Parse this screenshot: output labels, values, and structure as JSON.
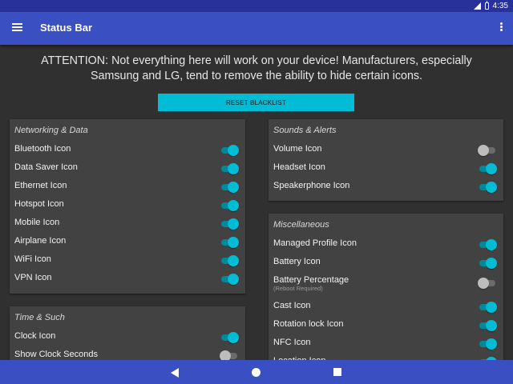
{
  "status_bar": {
    "time": "4:35"
  },
  "app_bar": {
    "title": "Status Bar"
  },
  "attention": "ATTENTION: Not everything here will work on your device! Manufacturers, especially Samsung and LG, tend to remove the ability to hide certain icons.",
  "reset_button": "RESET BLACKLIST",
  "networking": {
    "title": "Networking & Data",
    "items": [
      {
        "label": "Bluetooth Icon",
        "on": true
      },
      {
        "label": "Data Saver Icon",
        "on": true
      },
      {
        "label": "Ethernet Icon",
        "on": true
      },
      {
        "label": "Hotspot Icon",
        "on": true
      },
      {
        "label": "Mobile Icon",
        "on": true
      },
      {
        "label": "Airplane Icon",
        "on": true
      },
      {
        "label": "WiFi Icon",
        "on": true
      },
      {
        "label": "VPN Icon",
        "on": true
      }
    ]
  },
  "time_such": {
    "title": "Time & Such",
    "items": [
      {
        "label": "Clock Icon",
        "on": true
      },
      {
        "label": "Show Clock Seconds",
        "on": false
      }
    ]
  },
  "sounds": {
    "title": "Sounds & Alerts",
    "items": [
      {
        "label": "Volume Icon",
        "on": false
      },
      {
        "label": "Headset Icon",
        "on": true
      },
      {
        "label": "Speakerphone Icon",
        "on": true
      }
    ]
  },
  "misc": {
    "title": "Miscellaneous",
    "items": [
      {
        "label": "Managed Profile Icon",
        "on": true
      },
      {
        "label": "Battery Icon",
        "on": true
      },
      {
        "label": "Battery Percentage",
        "sub": "(Reboot Required)",
        "on": false
      },
      {
        "label": "Cast Icon",
        "on": true
      },
      {
        "label": "Rotation lock Icon",
        "on": true
      },
      {
        "label": "NFC Icon",
        "on": true
      },
      {
        "label": "Location Icon",
        "on": true
      }
    ]
  },
  "colors": {
    "app_bar": "#3a50c2",
    "status_bar": "#28319a",
    "accent": "#00bcd4",
    "background": "#303030",
    "card": "#424242"
  },
  "icons": [
    "menu-icon",
    "overflow-icon",
    "signal-icon",
    "battery-icon",
    "back-icon",
    "home-icon",
    "recents-icon"
  ]
}
